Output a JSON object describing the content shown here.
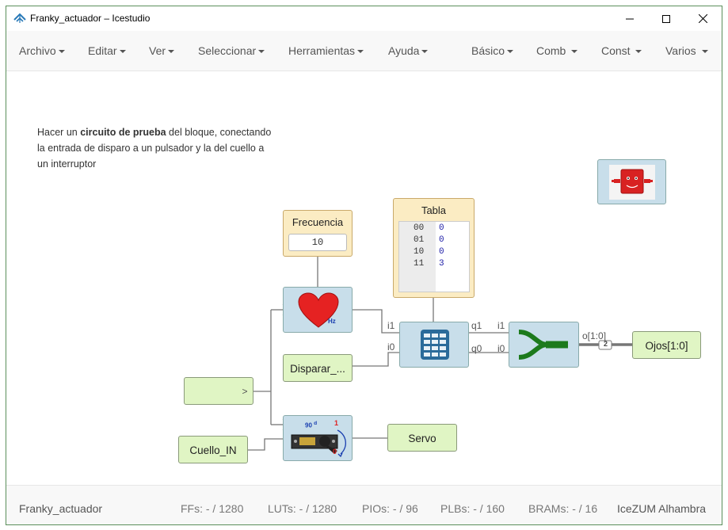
{
  "window": {
    "title": "Franky_actuador – Icestudio"
  },
  "menu": {
    "left": [
      "Archivo",
      "Editar",
      "Ver",
      "Seleccionar",
      "Herramientas",
      "Ayuda"
    ],
    "right": [
      "Básico",
      "Comb",
      "Const",
      "Varios"
    ]
  },
  "canvas": {
    "info": {
      "part1": "Hacer un ",
      "bold": "circuito de prueba",
      "part2": " del bloque, conectando la entrada de disparo a un pulsador y la del cuello a un interruptor"
    },
    "freq_block": {
      "label": "Frecuencia",
      "value": "10"
    },
    "table_block": {
      "label": "Tabla",
      "rows": [
        {
          "key": "00",
          "val": "0"
        },
        {
          "key": "01",
          "val": "0"
        },
        {
          "key": "10",
          "val": "0"
        },
        {
          "key": "11",
          "val": "3"
        }
      ]
    },
    "pins": {
      "table_in1": "i1",
      "table_in0": "i0",
      "table_out1": "q1",
      "table_out0": "q0",
      "join_in1": "i1",
      "join_in0": "i0",
      "join_out": "o[1:0]",
      "bus_width": "2"
    },
    "clock_icon_text": "Hz",
    "servo_icon": {
      "angle": "90",
      "deg": "d",
      "one": "1",
      "zero": "0"
    },
    "input_trigger": "Disparar_...",
    "input_empty_arrow": ">",
    "input_neck": "Cuello_IN",
    "output_servo": "Servo",
    "output_eyes": "Ojos[1:0]"
  },
  "status": {
    "project": "Franky_actuador",
    "ffs": "FFs:  - / 1280",
    "luts": "LUTs:  - / 1280",
    "pios": "PIOs:  - / 96",
    "plbs": "PLBs:  - / 160",
    "brams": "BRAMs:  - / 16",
    "board": "IceZUM Alhambra"
  },
  "colors": {
    "block_blue": "#c8deea",
    "block_green": "#e0f5c4",
    "block_tan": "#fbecc3",
    "heart": "#e52222",
    "join_green": "#1c7a1c"
  }
}
